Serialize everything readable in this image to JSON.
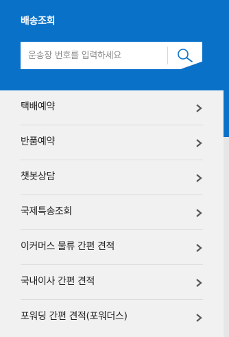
{
  "header": {
    "title": "배송조회",
    "background_color": "#0a71c8"
  },
  "search": {
    "placeholder": "운송장 번호를 입력하세요",
    "value": "",
    "button_icon": "search-icon"
  },
  "menu": {
    "background_color": "#f1f1f1",
    "items": [
      {
        "label": "택배예약",
        "icon": "chevron-right-icon"
      },
      {
        "label": "반품예약",
        "icon": "chevron-right-icon"
      },
      {
        "label": "챗봇상담",
        "icon": "chevron-right-icon"
      },
      {
        "label": "국제특송조회",
        "icon": "chevron-right-icon"
      },
      {
        "label": "이커머스 물류 간편 견적",
        "icon": "chevron-right-icon"
      },
      {
        "label": "국내이사 간편 견적",
        "icon": "chevron-right-icon"
      },
      {
        "label": "포워딩 간편 견적(포워더스)",
        "icon": "chevron-right-icon"
      }
    ]
  }
}
